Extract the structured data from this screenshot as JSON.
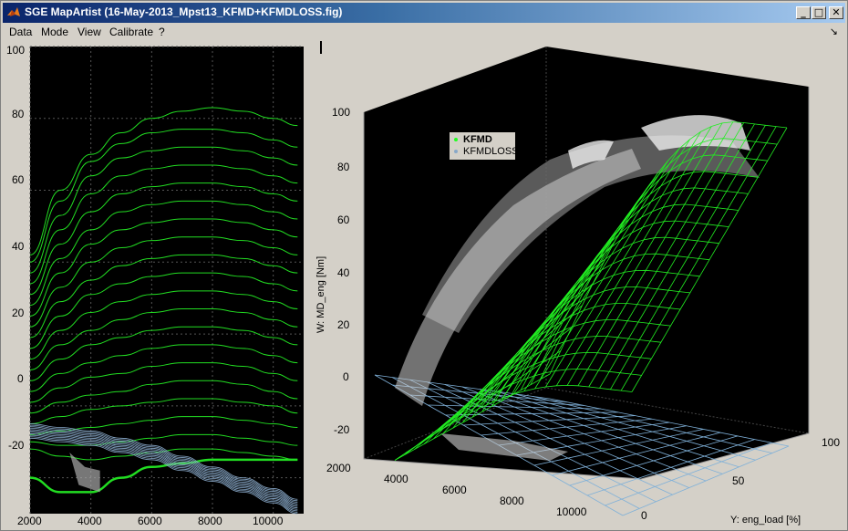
{
  "window": {
    "title": "SGE MapArtist (16-May-2013_Mpst13_KFMD+KFMDLOSS.fig)",
    "buttons": {
      "minimize": "_",
      "maximize": "□",
      "close": "✕"
    }
  },
  "menu": {
    "items": [
      "Data",
      "Mode",
      "View",
      "Calibrate",
      "?"
    ],
    "dock_icon": "↘"
  },
  "left_axes": {
    "x_ticks": [
      "2000",
      "4000",
      "6000",
      "8000",
      "10000"
    ],
    "y_ticks": [
      "100",
      "80",
      "60",
      "40",
      "20",
      "0",
      "-20"
    ]
  },
  "right_axes": {
    "z_label": "W: MD_eng [Nm]",
    "y_label": "Y: eng_load [%]",
    "z_ticks": [
      "100",
      "80",
      "60",
      "40",
      "20",
      "0",
      "-20"
    ],
    "x_ticks": [
      "2000",
      "4000",
      "6000",
      "8000",
      "10000"
    ],
    "y_ticks": [
      "0",
      "50",
      "100"
    ],
    "legend": [
      {
        "label": "KFMD",
        "color": "#22ff22"
      },
      {
        "label": "KFMDLOSS",
        "color": "#88a8c8"
      }
    ]
  },
  "chart_data": [
    {
      "type": "line",
      "x": [
        2000,
        3000,
        4000,
        5000,
        6000,
        7000,
        8000,
        9000,
        10000,
        10800
      ],
      "xlim": [
        2000,
        11000
      ],
      "ylim": [
        -30,
        100
      ],
      "series": [
        {
          "values": [
            42,
            60,
            70,
            76,
            80,
            82,
            83,
            82,
            80,
            78
          ]
        },
        {
          "values": [
            40,
            57,
            68,
            73,
            76,
            77,
            77,
            76,
            74,
            72
          ]
        },
        {
          "values": [
            37,
            53,
            64,
            69,
            71,
            72,
            72,
            71,
            69,
            67
          ]
        },
        {
          "values": [
            34,
            49,
            59,
            64,
            66,
            67,
            67,
            66,
            64,
            62
          ]
        },
        {
          "values": [
            31,
            45,
            54,
            59,
            61,
            62,
            62,
            61,
            59,
            57
          ]
        },
        {
          "values": [
            28,
            41,
            49,
            54,
            56,
            57,
            57,
            56,
            54,
            52
          ]
        },
        {
          "values": [
            25,
            37,
            45,
            49,
            51,
            52,
            52,
            51,
            49,
            47
          ]
        },
        {
          "values": [
            22,
            33,
            40,
            44,
            46,
            47,
            47,
            46,
            44,
            42
          ]
        },
        {
          "values": [
            19,
            29,
            35,
            39,
            41,
            42,
            42,
            41,
            39,
            37
          ]
        },
        {
          "values": [
            16,
            25,
            31,
            34,
            36,
            37,
            37,
            36,
            34,
            32
          ]
        },
        {
          "values": [
            13,
            21,
            26,
            29,
            31,
            32,
            32,
            31,
            29,
            27
          ]
        },
        {
          "values": [
            10,
            17,
            21,
            24,
            26,
            27,
            27,
            26,
            24,
            22
          ]
        },
        {
          "values": [
            7,
            13,
            17,
            19,
            21,
            22,
            22,
            21,
            19,
            17
          ]
        },
        {
          "values": [
            4,
            9,
            12,
            14,
            16,
            17,
            17,
            16,
            14,
            12
          ]
        },
        {
          "values": [
            1,
            5,
            8,
            9,
            11,
            12,
            12,
            11,
            9,
            7
          ]
        },
        {
          "values": [
            -2,
            1,
            3,
            4,
            6,
            7,
            7,
            6,
            4,
            2
          ]
        },
        {
          "values": [
            -5,
            -3,
            -1,
            0,
            1,
            2,
            2,
            1,
            0,
            -2
          ]
        },
        {
          "values": [
            -8,
            -7,
            -6,
            -5,
            -4,
            -3,
            -3,
            -4,
            -5,
            -6
          ]
        },
        {
          "values": [
            -10,
            -11,
            -11,
            -10,
            -9,
            -8,
            -8,
            -9,
            -10,
            -11
          ]
        },
        {
          "values": [
            -12,
            -14,
            -15,
            -14,
            -13,
            -12,
            -12,
            -13,
            -14,
            -15
          ]
        },
        {
          "values": [
            -20,
            -24,
            -24,
            -20,
            -17,
            -16,
            -15,
            -15,
            -15,
            -15
          ]
        }
      ]
    },
    {
      "type": "line",
      "x": [
        2000,
        3000,
        4000,
        5000,
        6000,
        7000,
        8000,
        9000,
        10000,
        10800
      ],
      "xlim": [
        2000,
        11000
      ],
      "ylim": [
        -30,
        100
      ],
      "series": [
        {
          "values": [
            -5,
            -6,
            -7,
            -9,
            -11,
            -14,
            -17,
            -20,
            -23,
            -26
          ]
        },
        {
          "values": [
            -9,
            -10,
            -11,
            -13,
            -15,
            -18,
            -21,
            -24,
            -27,
            -30
          ]
        }
      ]
    }
  ]
}
